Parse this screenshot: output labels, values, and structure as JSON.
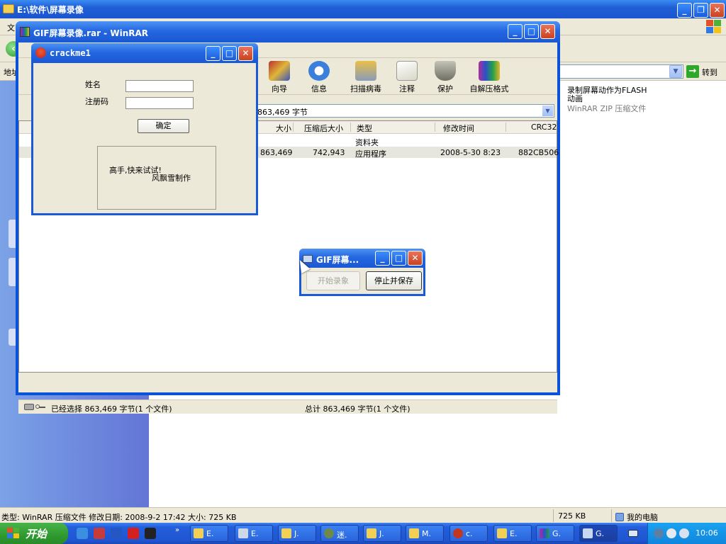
{
  "explorer": {
    "title": "E:\\软件\\屏幕录像",
    "menu_partial": "文",
    "address_label": "地址",
    "go_label": "转到",
    "file_item": {
      "name_line1": "录制屏幕动作为FLASH",
      "name_line2": "动画",
      "type": "WinRAR ZIP 压缩文件"
    },
    "status": {
      "info": "类型: WinRAR 压缩文件 修改日期: 2008-9-2 17:42 大小: 725 KB",
      "size": "725 KB",
      "location": "我的电脑"
    }
  },
  "winrar": {
    "title": "GIF屏幕录像.rar - WinRAR",
    "toolbar": [
      "向导",
      "信息",
      "扫描病毒",
      "注释",
      "保护",
      "自解压格式"
    ],
    "path_text": "863,469 字节",
    "columns": [
      "大小",
      "压缩后大小",
      "类型",
      "修改时间",
      "CRC32"
    ],
    "rows": [
      {
        "size": "",
        "packed": "",
        "type": "资料夹",
        "modified": "",
        "crc": ""
      },
      {
        "size": "863,469",
        "packed": "742,943",
        "type": "应用程序",
        "modified": "2008-5-30 8:23",
        "crc": "882CB506"
      }
    ],
    "status": {
      "selected": "已经选择 863,469 字节(1 个文件)",
      "total": "总计 863,469 字节(1 个文件)"
    }
  },
  "crackme": {
    "title": "crackme1",
    "name_label": "姓名",
    "code_label": "注册码",
    "name_value": "",
    "code_value": "",
    "ok_label": "确定",
    "message_line1": "高手,快来试试!",
    "message_line2": "风飘雪制作"
  },
  "gif_recorder": {
    "title": "GIF屏幕...",
    "start_label": "开始录象",
    "stop_label": "停止并保存"
  },
  "taskbar": {
    "start_label": "开始",
    "tasks": [
      "E.",
      "E.",
      "J.",
      "迷.",
      "J.",
      "M.",
      "c.",
      "E.",
      "G.",
      "G."
    ],
    "clock": "10:06"
  }
}
